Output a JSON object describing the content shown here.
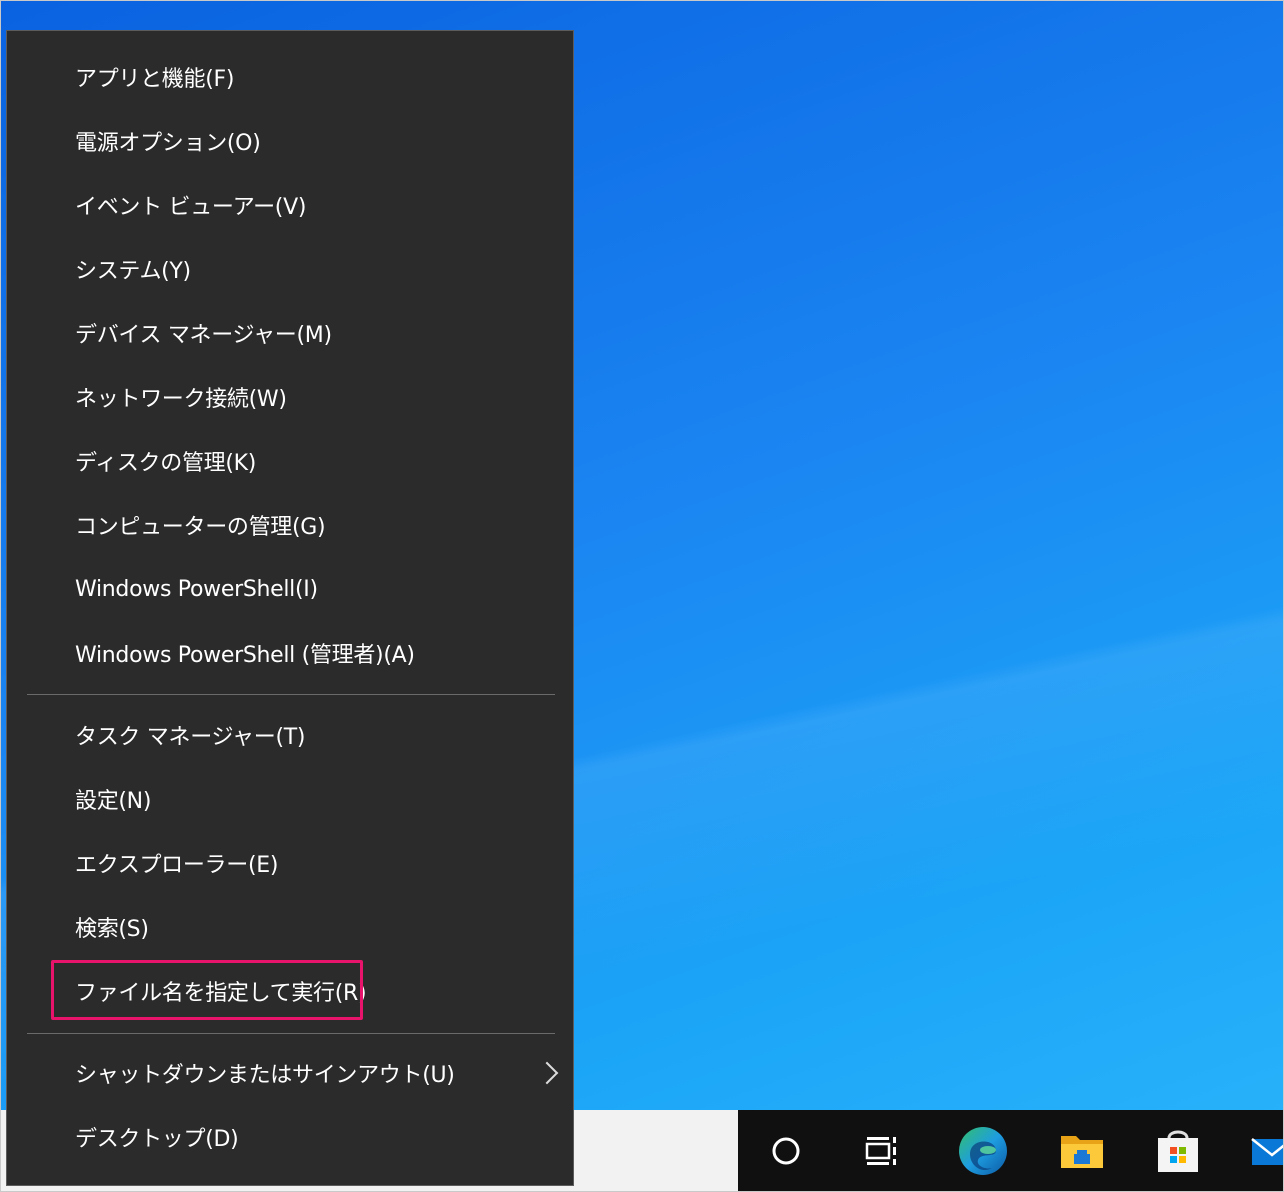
{
  "menu": {
    "group1": [
      "アプリと機能(F)",
      "電源オプション(O)",
      "イベント ビューアー(V)",
      "システム(Y)",
      "デバイス マネージャー(M)",
      "ネットワーク接続(W)",
      "ディスクの管理(K)",
      "コンピューターの管理(G)",
      "Windows PowerShell(I)",
      "Windows PowerShell (管理者)(A)"
    ],
    "group2": [
      "タスク マネージャー(T)",
      "設定(N)",
      "エクスプローラー(E)",
      "検索(S)",
      "ファイル名を指定して実行(R)"
    ],
    "group3": [
      "シャットダウンまたはサインアウト(U)",
      "デスクトップ(D)"
    ],
    "highlighted_item": "ファイル名を指定して実行(R)",
    "highlight_color": "#e8146b",
    "background_color": "#2b2b2b"
  },
  "taskbar": {
    "icons": [
      "cortana-icon",
      "task-view-icon",
      "edge-icon",
      "file-explorer-icon",
      "store-icon",
      "mail-icon"
    ]
  },
  "colors": {
    "desktop": "#1a7fe8",
    "taskbar": "#101010",
    "search_box": "#f2f2f2"
  }
}
